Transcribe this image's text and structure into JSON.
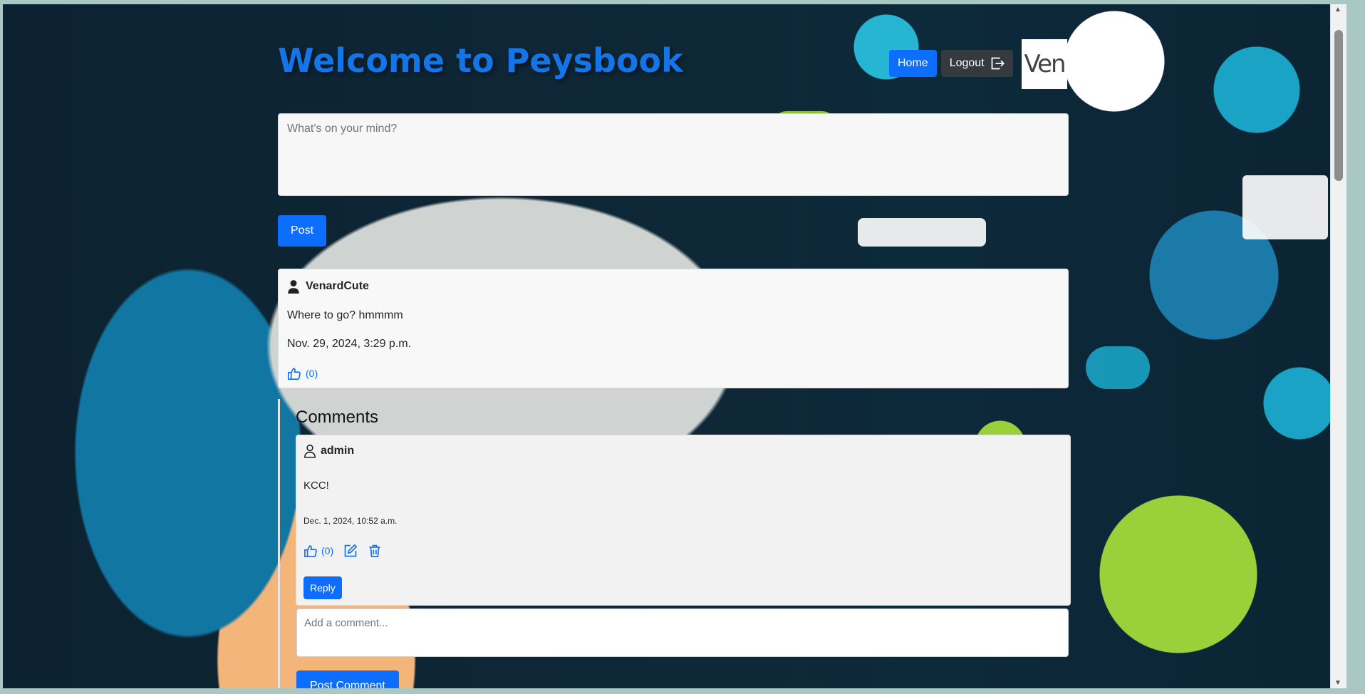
{
  "header": {
    "title": "Welcome to Peysbook",
    "home_label": "Home",
    "logout_label": "Logout",
    "logo_text": "Ven"
  },
  "composer": {
    "placeholder": "What's on your mind?",
    "post_label": "Post"
  },
  "post": {
    "author": "VenardCute",
    "text": "Where to go? hmmmm",
    "date": "Nov. 29, 2024, 3:29 p.m.",
    "likes": "(0)"
  },
  "comments": {
    "title": "Comments",
    "items": [
      {
        "author": "admin",
        "text": "KCC!",
        "date": "Dec. 1, 2024, 10:52 a.m.",
        "likes": "(0)",
        "reply_label": "Reply"
      }
    ],
    "input_placeholder": "Add a comment...",
    "post_comment_label": "Post Comment"
  },
  "icons": {
    "user": "person-fill-icon",
    "user_outline": "person-outline-icon",
    "like": "thumbs-up-icon",
    "edit": "pencil-square-icon",
    "delete": "trash-icon",
    "logout": "box-arrow-right-icon"
  },
  "colors": {
    "primary": "#0d6efd",
    "title": "#1475e8",
    "dark": "#343a40"
  }
}
